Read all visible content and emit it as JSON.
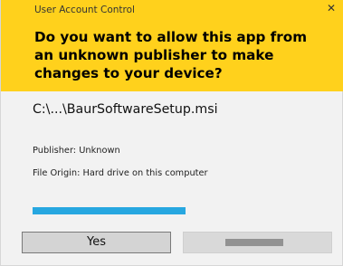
{
  "dialog": {
    "window_title": "User Account Control",
    "close_glyph": "✕",
    "question": "Do you want to allow this app from an unknown publisher to make changes to your device?",
    "file_name": "C:\\...\\BaurSoftwareSetup.msi",
    "publisher": "Publisher: Unknown",
    "file_origin": "File Origin: Hard drive on this computer",
    "progress_percent": 100
  },
  "buttons": {
    "yes_label": "Yes"
  },
  "colors": {
    "header": "#ffd11c",
    "progress": "#27a7e0",
    "background": "#f2f2f2"
  }
}
